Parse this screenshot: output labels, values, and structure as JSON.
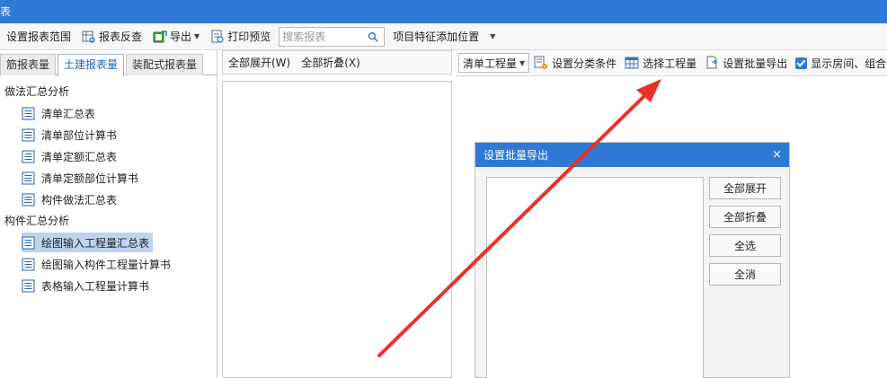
{
  "window": {
    "title": "表"
  },
  "toolbar": {
    "report_range": "设置报表范围",
    "report_check": "报表反查",
    "export": "导出",
    "print_preview": "打印预览",
    "search_placeholder": "搜索报表",
    "feature_pos": "项目特征添加位置"
  },
  "left_panel": {
    "tabs": [
      {
        "label": "筋报表量"
      },
      {
        "label": "土建报表量"
      },
      {
        "label": "装配式报表量"
      }
    ],
    "groups": [
      {
        "label": "做法汇总分析",
        "items": [
          {
            "label": "清单汇总表"
          },
          {
            "label": "清单部位计算书"
          },
          {
            "label": "清单定额汇总表"
          },
          {
            "label": "清单定额部位计算书"
          },
          {
            "label": "构件做法汇总表"
          }
        ]
      },
      {
        "label": "构件汇总分析",
        "items": [
          {
            "label": "绘图输入工程量汇总表"
          },
          {
            "label": "绘图输入构件工程量计算书"
          },
          {
            "label": "表格输入工程量计算书"
          }
        ]
      }
    ]
  },
  "middle": {
    "expand_all": "全部展开(W)",
    "collapse_all": "全部折叠(X)"
  },
  "right_toolbar": {
    "select_value": "清单工程量",
    "set_category": "设置分类条件",
    "choose_quantity": "选择工程量",
    "batch_export": "设置批量导出",
    "show_rooms": "显示房间、组合"
  },
  "dialog": {
    "title": "设置批量导出",
    "close": "×",
    "buttons": {
      "expand_all": "全部展开",
      "collapse_all": "全部折叠",
      "select_all": "全选",
      "deselect_all": "全消"
    }
  },
  "colors": {
    "accent": "#2f7ad6",
    "arrow": "#e8322b",
    "selected": "#bcd3ef"
  }
}
